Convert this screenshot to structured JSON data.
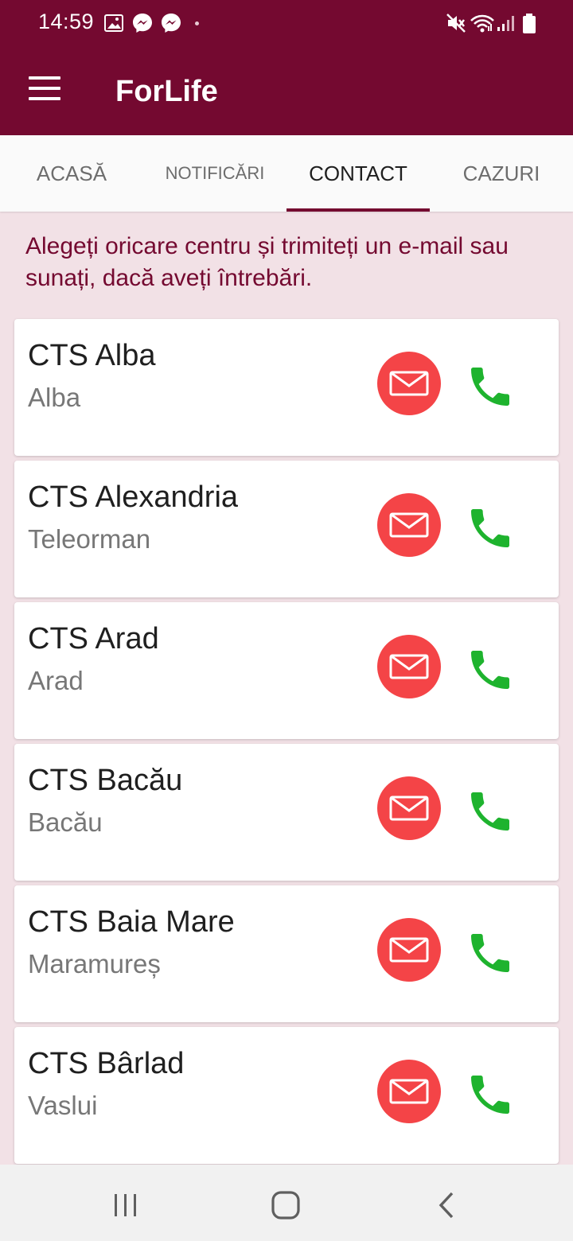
{
  "status_bar": {
    "time": "14:59",
    "icons": [
      "gallery-icon",
      "messenger-icon",
      "messenger-icon",
      "dot-icon",
      "mute-icon",
      "wifi-icon",
      "signal-icon",
      "battery-icon"
    ]
  },
  "app_bar": {
    "title": "ForLife",
    "menu_icon": "menu-icon"
  },
  "tabs": [
    {
      "label": "ACASĂ",
      "active": false
    },
    {
      "label": "NOTIFICĂRI",
      "active": false
    },
    {
      "label": "CONTACT",
      "active": true
    },
    {
      "label": "CAZURI",
      "active": false
    }
  ],
  "intro_text": "Alegeți oricare centru și trimiteți un e-mail sau sunați, dacă aveți întrebări.",
  "centers": [
    {
      "name": "CTS Alba",
      "county": "Alba"
    },
    {
      "name": "CTS Alexandria",
      "county": "Teleorman"
    },
    {
      "name": "CTS Arad",
      "county": "Arad"
    },
    {
      "name": "CTS Bacău",
      "county": "Bacău"
    },
    {
      "name": "CTS Baia Mare",
      "county": "Maramureș"
    },
    {
      "name": "CTS Bârlad",
      "county": "Vaslui"
    }
  ],
  "actions": {
    "email_icon": "envelope-icon",
    "call_icon": "phone-icon"
  },
  "colors": {
    "primary": "#740930",
    "background": "#f2e1e6",
    "email_button": "#f44447",
    "phone_icon": "#1eb32e",
    "tab_inactive": "#6d6d6d",
    "tab_active": "#1f1f1f"
  },
  "nav_bar": {
    "icons": [
      "recent-apps-icon",
      "home-icon",
      "back-icon"
    ]
  }
}
